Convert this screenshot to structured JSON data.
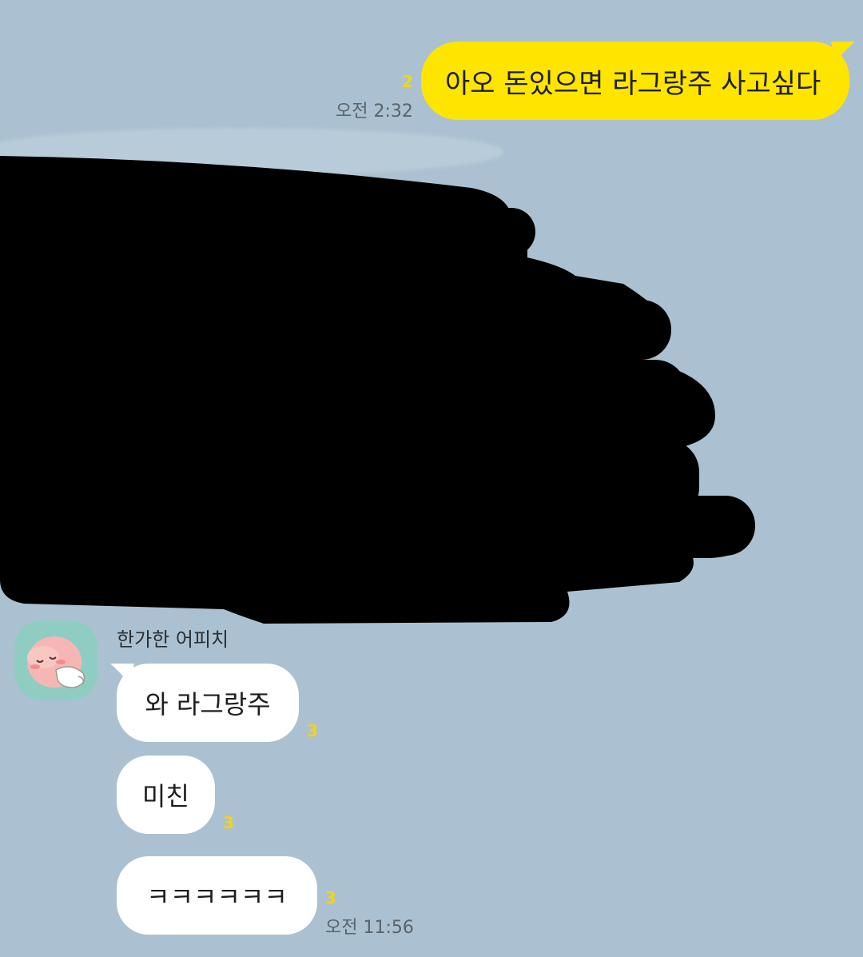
{
  "messages": {
    "outgoing": {
      "text": "아오 돈있으면 라그랑주 사고싶다",
      "unread": "2",
      "time": "오전 2:32"
    },
    "incoming": {
      "sender": "한가한 어피치",
      "avatar_icon": "apeach-sleeping-icon",
      "items": [
        {
          "text": "와 라그랑주",
          "unread": "3"
        },
        {
          "text": "미친",
          "unread": "3"
        },
        {
          "text": "ㅋㅋㅋㅋㅋㅋ",
          "unread": "3",
          "time": "오전 11:56"
        }
      ]
    }
  },
  "colors": {
    "background": "#abc1d1",
    "outgoing_bubble": "#fee500",
    "incoming_bubble": "#ffffff",
    "unread_count": "#f2d41c",
    "redaction": "#000000"
  }
}
